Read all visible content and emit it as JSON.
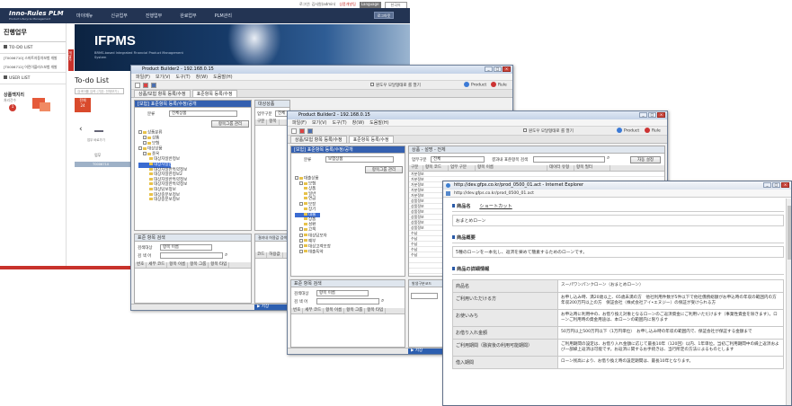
{
  "util_bar": {
    "links": [
      "로그인: 김사원(admin)",
      "상품개발팀",
      "Language",
      "한국어"
    ]
  },
  "main_page": {
    "logo": "Inno-Rules PLM",
    "logo_sub": "Product Lifecycle Management",
    "menu": [
      "마이메뉴",
      "신규업무",
      "진행업무",
      "완료업무",
      "PLM관리"
    ],
    "login_button": "로그아웃",
    "sidebar_title": "진행업무",
    "sidebar_sections": [
      "TO-DO LIST",
      "USER LIST"
    ],
    "sidebar_items": [
      "[T0006710] 스마트자동차보험 개발",
      "[T0006712] 어린이플러스보험 개발"
    ],
    "sidebar_widget_title": "상품백지리",
    "sidebar_widget_sub": "처리건수",
    "sidebar_badge": "1",
    "banner_title": "IFPMS",
    "banner_sub": "BRMS-based Integrated Financial Product Management System",
    "banner_side_tab": "개발자",
    "todo_title": "To-do List",
    "todo_search_placeholder": "검색어를 입력 (기본: 전체보기)",
    "todo_tab_active": "전체",
    "todo_tab_count": "24",
    "todo_col": "업무",
    "todo_row": "T0006710",
    "link_label": "업무 바로가기"
  },
  "window1": {
    "title": "Product Builder2 - 192.168.0.15",
    "menu": [
      "파일(F)",
      "보기(V)",
      "도구(T)",
      "창(W)",
      "도움말(H)"
    ],
    "toolbar_check": "원도우 모달형태로 를 열기",
    "product_btn": "Product",
    "rule_btn": "Rule",
    "tabs": [
      "상품/보험 항목 등록/수정",
      "표준항목 등록/수정"
    ],
    "panel_title": "[보험] 표준항목 등록/수정/공개",
    "search_label": "분류",
    "search_value": "전체상품",
    "register_button": "항목그룹 관리",
    "tree": [
      "상품분류",
      "상품",
      "보험",
      "대상상품",
      "종목",
      "대상자일반정보",
      "대상자일반정보",
      "대상자일반특약정보",
      "대상자일반정보2",
      "대상자일반특약정보",
      "대상자일반특약정보",
      "대상담보정보",
      "대상중분보정보",
      "대상중분보정보"
    ],
    "right_tabs": [
      "대상상품",
      "공통",
      "상품정보관리"
    ],
    "right_label": "업무구분",
    "right_value": "전체",
    "right_col": "구분",
    "right_col2": "항목",
    "bottom_panel": "표준 항목 검색",
    "bottom_search_label": "검색대상",
    "bottom_search_value": "항목 이름",
    "bottom_keyword_label": "검 색 어",
    "bottom_cols": [
      "번호",
      "세부 코드",
      "항목 이름",
      "항목 그룹",
      "항목 타입"
    ],
    "right_bottom": "결과내 허용값 검색",
    "right_bottom_cols": [
      "코드",
      "허용값"
    ],
    "status_left": "▶ 저장",
    "status_right": "192.168.0.15"
  },
  "window2": {
    "title": "Product Builder2 - 192.168.0.15",
    "menu": [
      "파일(F)",
      "보기(V)",
      "도구(T)",
      "창(W)",
      "도움말(H)"
    ],
    "toolbar_check": "원도우 모달형태로 를 열기",
    "product_btn": "Product",
    "rule_btn": "Rule",
    "tabs": [
      "상품/보험 항목 등록/수정",
      "표준항목 등록/수정"
    ],
    "panel_title": "[보험] 표준항목 등록/수정/공개",
    "search_label": "분류",
    "search_value": "보험상품",
    "register_button": "항목그룹 관리",
    "tree": [
      "대출상품",
      "보험",
      "상품",
      "일반",
      "연금",
      "보장",
      "장기",
      "대출",
      "상품",
      "성환",
      "고객",
      "대상담보자",
      "예부",
      "대상고객보장",
      "대출특약"
    ],
    "right_tabs": [
      "상품",
      "설명",
      "전체"
    ],
    "right_label": "업무구분",
    "right_value": "전체",
    "right_search": "결과내 표준항목 검색",
    "right_button": "자동 설정",
    "right_cols": [
      "구분",
      "항목 코드",
      "업무 구분",
      "항목 이름",
      "데이터 유형",
      "항목 필터"
    ],
    "rows": [
      "가분정보",
      "가분정보",
      "가분정보",
      "가분정보",
      "가분정보",
      "상품정보",
      "상품정보",
      "상품정보",
      "상품정보",
      "상품정보",
      "상품정보",
      "수납",
      "수납",
      "수납",
      "수납",
      "수납"
    ],
    "bottom_panel": "표준 항목 검색",
    "bottom_search_label": "검색대상",
    "bottom_search_value": "항목 이름",
    "bottom_keyword_label": "검 색 어",
    "bottom_cols": [
      "번호",
      "세부 코드",
      "항목 이름",
      "항목 그룹",
      "항목 타입"
    ],
    "right_bottom": "결과내 허용값 검색",
    "right_bottom2": "발생구분코드",
    "status_left": "▶ 저장",
    "status_right": "192.168.0.15"
  },
  "browser": {
    "title": "http://dev.gfps.co.kr/prod_0500_01.act - Internet Explorer",
    "address": "http://dev.gfps.co.kr/prod_0500_01.act",
    "section1_title": "商品名",
    "section1_name": "ショートカット",
    "section1_value": "おまとめローン",
    "section2_title": "商品概要",
    "section2_value": "5種のローンを一本化し、返済を楽めて簡素するためのローンです。",
    "section3_title": "商品の詳細情報",
    "rows": [
      {
        "label": "商品名",
        "value": "スーパワンパンクローン（おまとめローン）"
      },
      {
        "label": "ご利用いただける方",
        "value": "お申し込み時、満20歳以上、65歳未満の方　他社利用件数が5件以下で他社債務総額がお申込時の年収の範囲内の方　年収200万円以上の方　保証会社（株式会社アイ•エヌジー）の保証が受けられる方"
      },
      {
        "label": "お使いみち",
        "value": "お申込時に利用中の、お借り換え対象となるローンのご返済資金にご利用いただけます（事業性資金を除きます）。ローンご利用時の資金用途は、本ローンの範囲内に限ります"
      },
      {
        "label": "お借り入れ金額",
        "value": "50万円以上500万円以下（1万円単位）　お申し込み時の年収の範囲内で、保証会社が保証する金額まで"
      },
      {
        "label": "ご利用期間（融資後の利用可能期間）",
        "value": "ご利用期間の設定は、お借り入れ金額に応じて最長10年（120回）以内、1年単位。当初ご利用期間中の繰上返済および一部繰上返済は可能です。お返済に関するお手続きは、当行所定の方法によるものとします"
      },
      {
        "label": "借入期間",
        "value": "ローン残高により、お借り換え時の設定期間は、最長10年となります。"
      }
    ]
  }
}
